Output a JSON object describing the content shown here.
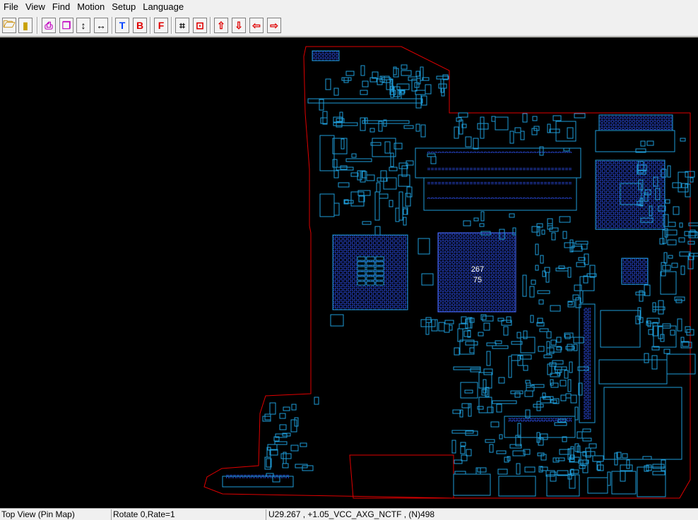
{
  "menu": {
    "file": "File",
    "view": "View",
    "find": "Find",
    "motion": "Motion",
    "setup": "Setup",
    "language": "Language"
  },
  "toolbar": {
    "buttons": [
      {
        "icon": "open-folder-icon",
        "glyph": "🗁"
      },
      {
        "icon": "exit-door-icon",
        "glyph": "▮"
      },
      {
        "icon": "print-preview-icon",
        "glyph": "⎙"
      },
      {
        "icon": "copy-icon",
        "glyph": "❐"
      },
      {
        "icon": "flip-vertical-icon",
        "glyph": "↕"
      },
      {
        "icon": "flip-horizontal-icon",
        "glyph": "↔"
      },
      {
        "icon": "top-side-icon",
        "glyph": "T"
      },
      {
        "icon": "bottom-side-icon",
        "glyph": "B"
      },
      {
        "icon": "flip-board-icon",
        "glyph": "F"
      },
      {
        "icon": "zoom-fit-icon",
        "glyph": "⌗"
      },
      {
        "icon": "zoom-area-icon",
        "glyph": "⊡"
      },
      {
        "icon": "move-up-icon",
        "glyph": "⇧"
      },
      {
        "icon": "move-down-icon",
        "glyph": "⇩"
      },
      {
        "icon": "move-left-icon",
        "glyph": "⇦"
      },
      {
        "icon": "move-right-icon",
        "glyph": "⇨"
      }
    ]
  },
  "board": {
    "pin_labels": [
      "267",
      "75"
    ],
    "colors": {
      "outline": "#e00000",
      "component": "#1e9bd7",
      "pins": "#1a3fd0",
      "label": "#ffffff"
    }
  },
  "status": {
    "view_mode": "Top View (Pin Map)",
    "rotate": "Rotate 0,Rate=1",
    "selection": "U29.267 , +1.05_VCC_AXG_NCTF , (N)498"
  }
}
